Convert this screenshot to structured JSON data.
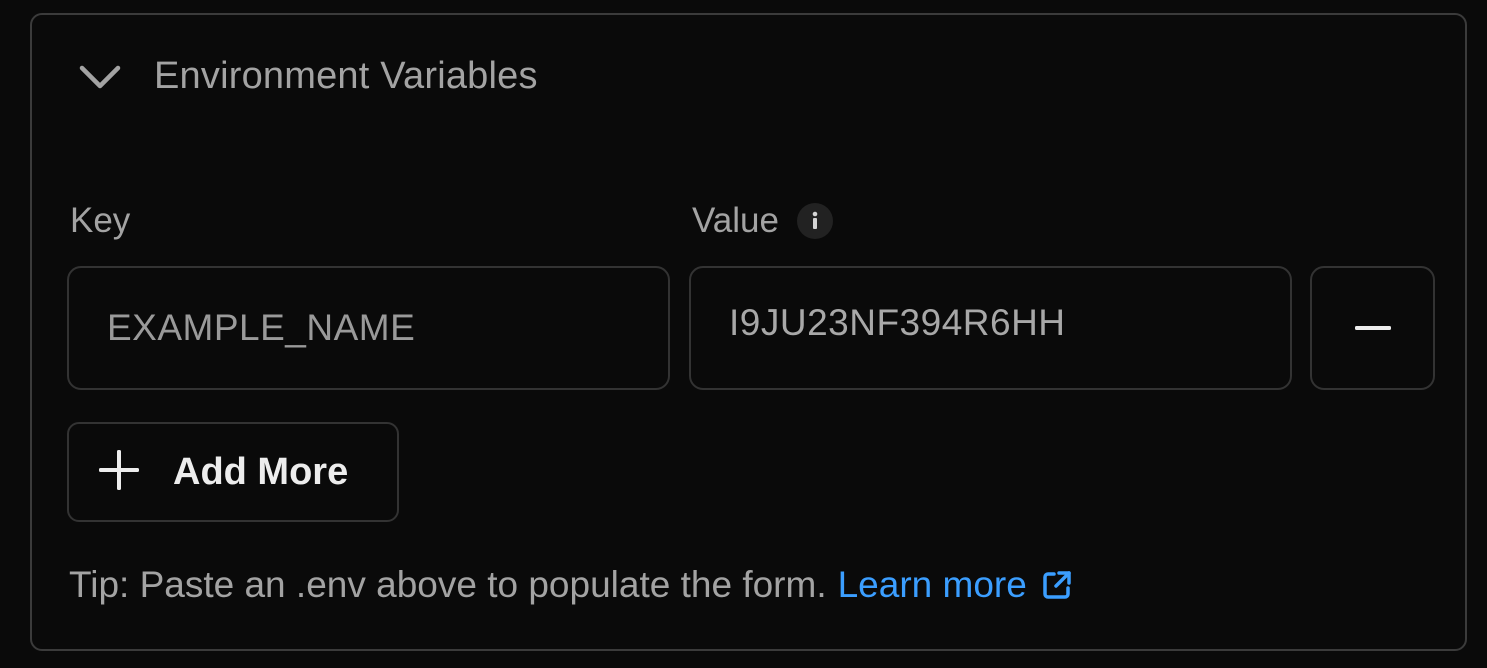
{
  "section": {
    "title": "Environment Variables",
    "expanded": true,
    "chevron_icon": "chevron-down-icon"
  },
  "labels": {
    "key": "Key",
    "value": "Value",
    "value_info_icon": "info-icon"
  },
  "row": {
    "key_placeholder": "EXAMPLE_NAME",
    "value_text": "I9JU23NF394R6HH",
    "remove_icon": "minus-icon"
  },
  "add_more": {
    "label": "Add More",
    "icon": "plus-icon"
  },
  "tip": {
    "text": "Tip: Paste an .env above to populate the form.",
    "link_label": "Learn more",
    "link_icon": "external-link-icon"
  },
  "colors": {
    "background": "#0a0a0a",
    "border": "#333333",
    "muted_text": "#a3a3a3",
    "link": "#3b9eff",
    "button_text": "#ededed"
  }
}
